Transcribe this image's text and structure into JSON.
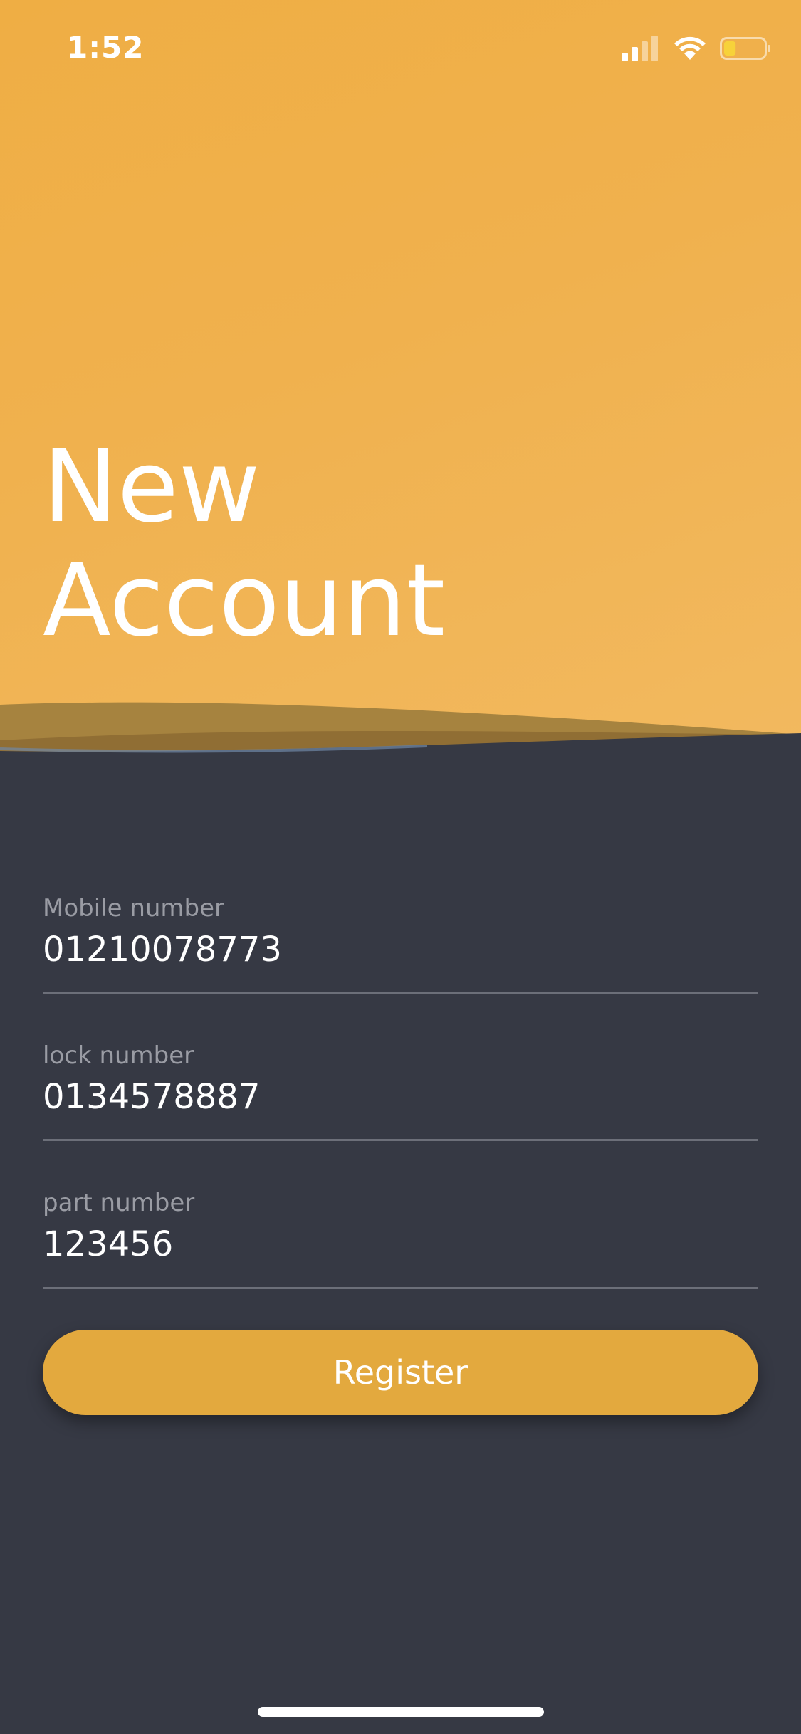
{
  "status_bar": {
    "time": "1:52",
    "signal_icon": "cellular-signal-icon",
    "wifi_icon": "wifi-icon",
    "battery_icon": "battery-icon",
    "battery_level": 0.3
  },
  "header": {
    "title_line1": "New",
    "title_line2": "Account"
  },
  "form": {
    "fields": [
      {
        "label": "Mobile number",
        "value": "01210078773"
      },
      {
        "label": "lock number",
        "value": "0134578887"
      },
      {
        "label": "part number",
        "value": "123456"
      }
    ],
    "register_label": "Register"
  },
  "colors": {
    "accent": "#e3a93e",
    "header_bg": "#f0b14e",
    "background": "#363944"
  }
}
